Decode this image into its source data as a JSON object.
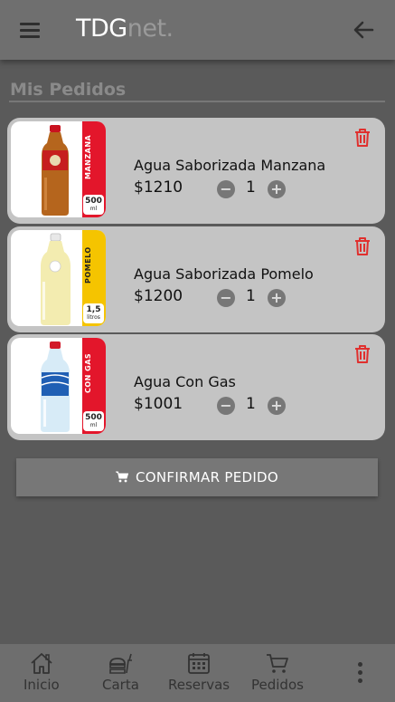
{
  "header": {
    "logo_main": "TDG",
    "logo_suffix": "net."
  },
  "section_title": "Mis Pedidos",
  "orders": [
    {
      "name": "Agua Saborizada Manzana",
      "price": "$1210",
      "quantity": "1",
      "band_text": "MANZANA",
      "volume": "500",
      "volume_unit": "ml",
      "band_color": "#e3162b",
      "liquid_color": "#b5651d"
    },
    {
      "name": "Agua Saborizada Pomelo",
      "price": "$1200",
      "quantity": "1",
      "band_text": "POMELO",
      "volume": "1,5",
      "volume_unit": "litros",
      "band_color": "#f5c400",
      "liquid_color": "#f3ecb0"
    },
    {
      "name": "Agua Con Gas",
      "price": "$1001",
      "quantity": "1",
      "band_text": "CON GAS",
      "volume": "500",
      "volume_unit": "ml",
      "band_color": "#e3162b",
      "liquid_color": "#cfe6f5"
    }
  ],
  "confirm_button": "CONFIRMAR PEDIDO",
  "bottom_nav": [
    {
      "label": "Inicio",
      "icon": "home-icon"
    },
    {
      "label": "Carta",
      "icon": "food-icon"
    },
    {
      "label": "Reservas",
      "icon": "calendar-icon"
    },
    {
      "label": "Pedidos",
      "icon": "cart-icon"
    }
  ],
  "colors": {
    "background": "#5a5a5a",
    "card": "#c4c4c4",
    "trash": "#e0302e"
  }
}
